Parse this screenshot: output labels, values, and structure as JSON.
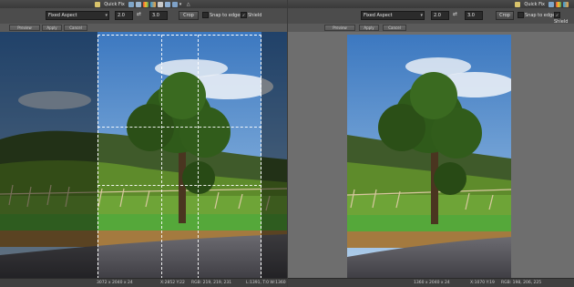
{
  "left": {
    "toolbar": {
      "quick_fix_label": "Quick Fix",
      "aspect_select": "Fixed Aspect",
      "width_value": "2.0",
      "height_value": "3.0",
      "crop_button": "Crop",
      "snap_label": "Snap to edges",
      "shield_label": "Shield"
    },
    "subbar": {
      "btn1": "Preview",
      "btn2": "Apply",
      "btn3": "Cancel"
    },
    "status": {
      "dims": "3072 x 2040 x 24",
      "coords": "X:2852 Y:22",
      "rgb": "RGB: 219, 219, 231",
      "crop": "L:1391, T:0  W:1360"
    }
  },
  "right": {
    "toolbar": {
      "quick_fix_label": "Quick Fix",
      "aspect_select": "Fixed Aspect",
      "width_value": "2.0",
      "height_value": "3.0",
      "crop_button": "Crop",
      "snap_label": "Snap to edges",
      "shield_label": "Shield"
    },
    "subbar": {
      "btn1": "Preview",
      "btn2": "Apply",
      "btn3": "Cancel"
    },
    "status": {
      "dims": "1360 x 2040 x 24",
      "coords": "X:1070 Y:19",
      "rgb": "RGB: 198, 206, 225"
    }
  },
  "icons": [
    "image-icon",
    "image-icon",
    "palette-icon",
    "color-drops-icon",
    "person-icon",
    "printer-icon",
    "funnel-icon"
  ]
}
